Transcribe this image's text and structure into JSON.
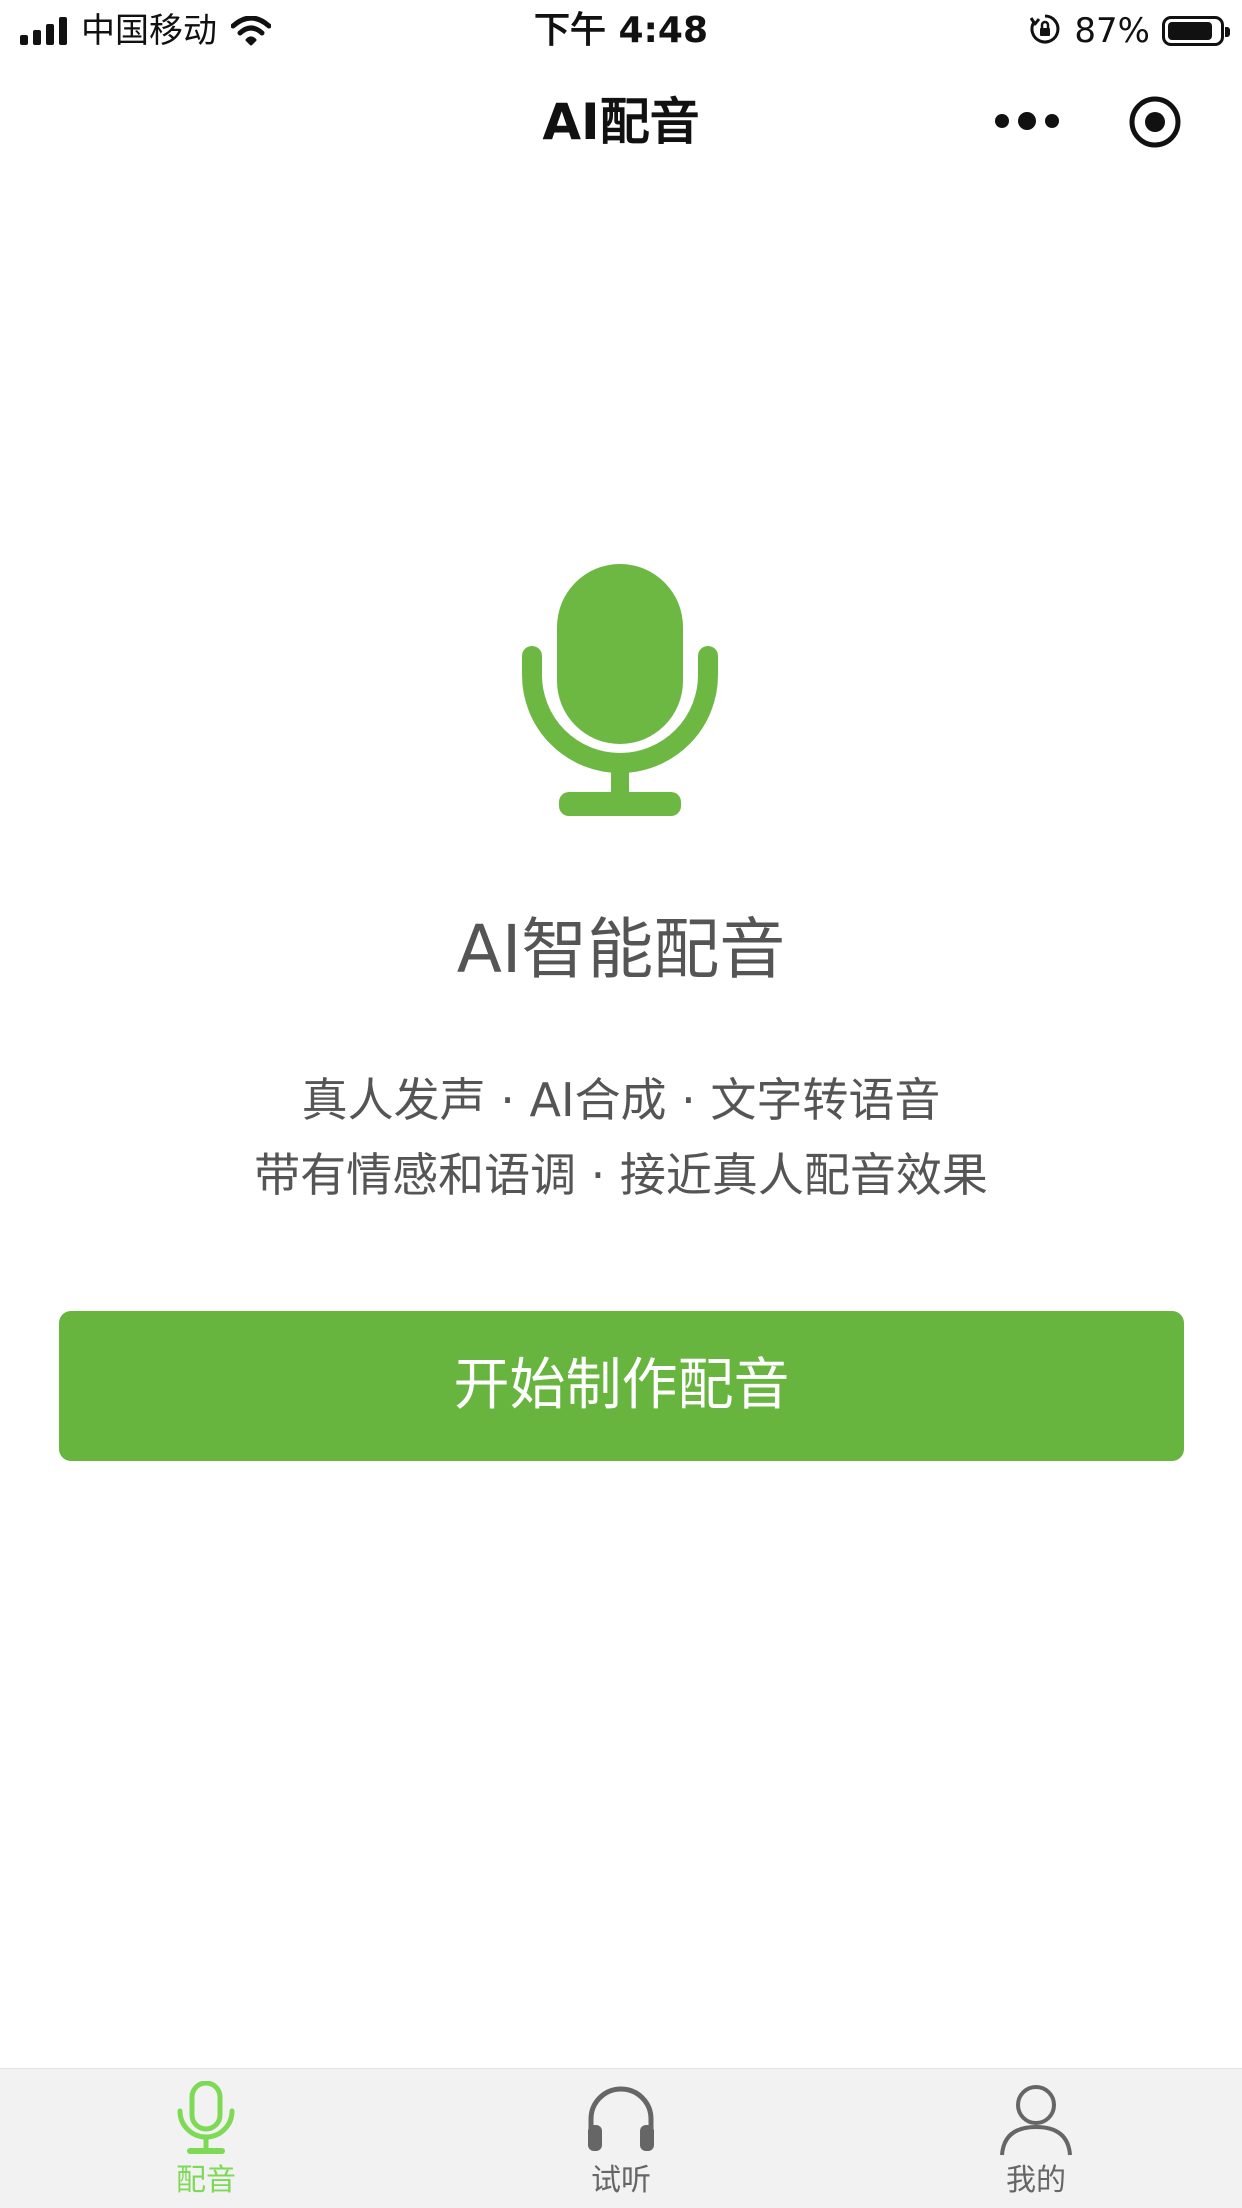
{
  "status_bar": {
    "carrier": "中国移动",
    "time": "下午 4:48",
    "battery_percent": "87%",
    "battery_level": 0.87,
    "icons": [
      "signal-icon",
      "wifi-icon",
      "orientation-lock-icon",
      "battery-icon"
    ]
  },
  "nav": {
    "title": "AI配音",
    "icons": [
      "more-icon",
      "close-target-icon"
    ]
  },
  "hero": {
    "icon": "microphone-icon",
    "title": "AI智能配音",
    "desc_line1": "真人发声 · AI合成 · 文字转语音",
    "desc_line2": "带有情感和语调 · 接近真人配音效果",
    "button_label": "开始制作配音"
  },
  "tabs": [
    {
      "label": "配音",
      "icon": "microphone-icon",
      "active": true
    },
    {
      "label": "试听",
      "icon": "headphones-icon",
      "active": false
    },
    {
      "label": "我的",
      "icon": "user-icon",
      "active": false
    }
  ],
  "colors": {
    "accent": "#67b43f",
    "accent_light": "#7ed957",
    "text_dark": "#111111",
    "text_muted": "#555555",
    "tab_bar_bg": "#f2f2f2"
  }
}
